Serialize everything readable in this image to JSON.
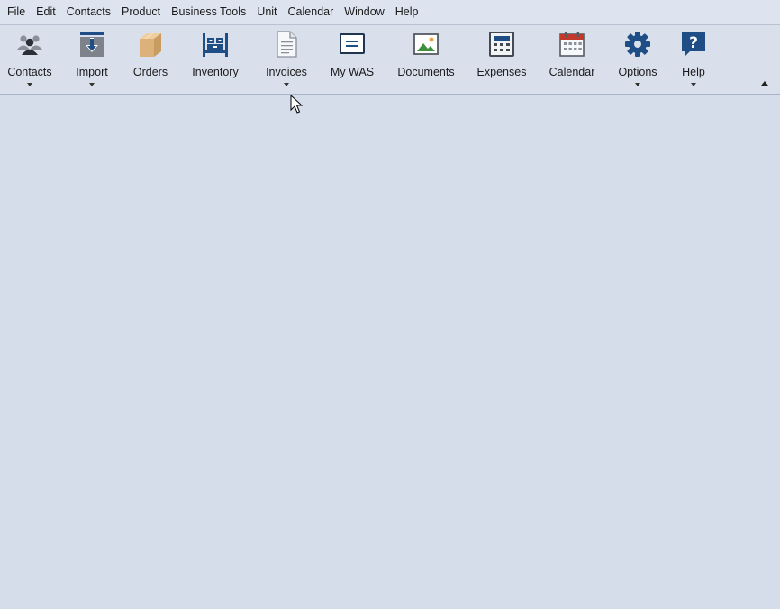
{
  "menu": [
    "File",
    "Edit",
    "Contacts",
    "Product",
    "Business Tools",
    "Unit",
    "Calendar",
    "Window",
    "Help"
  ],
  "toolbar": [
    {
      "label": "Contacts",
      "icon": "contacts-icon",
      "dropdown": true
    },
    {
      "label": "Import",
      "icon": "import-icon",
      "dropdown": true
    },
    {
      "label": "Orders",
      "icon": "orders-icon",
      "dropdown": false
    },
    {
      "label": "Inventory",
      "icon": "inventory-icon",
      "dropdown": false
    },
    {
      "label": "Invoices",
      "icon": "invoices-icon",
      "dropdown": true
    },
    {
      "label": "My WAS",
      "icon": "my-was-icon",
      "dropdown": false
    },
    {
      "label": "Documents",
      "icon": "documents-icon",
      "dropdown": false
    },
    {
      "label": "Expenses",
      "icon": "expenses-icon",
      "dropdown": false
    },
    {
      "label": "Calendar",
      "icon": "calendar-icon",
      "dropdown": false
    },
    {
      "label": "Options",
      "icon": "options-icon",
      "dropdown": true
    },
    {
      "label": "Help",
      "icon": "help-icon",
      "dropdown": true
    }
  ],
  "colors": {
    "accent": "#1f4e87",
    "background": "#d5dcea",
    "ribbon": "#d9e0ec"
  }
}
